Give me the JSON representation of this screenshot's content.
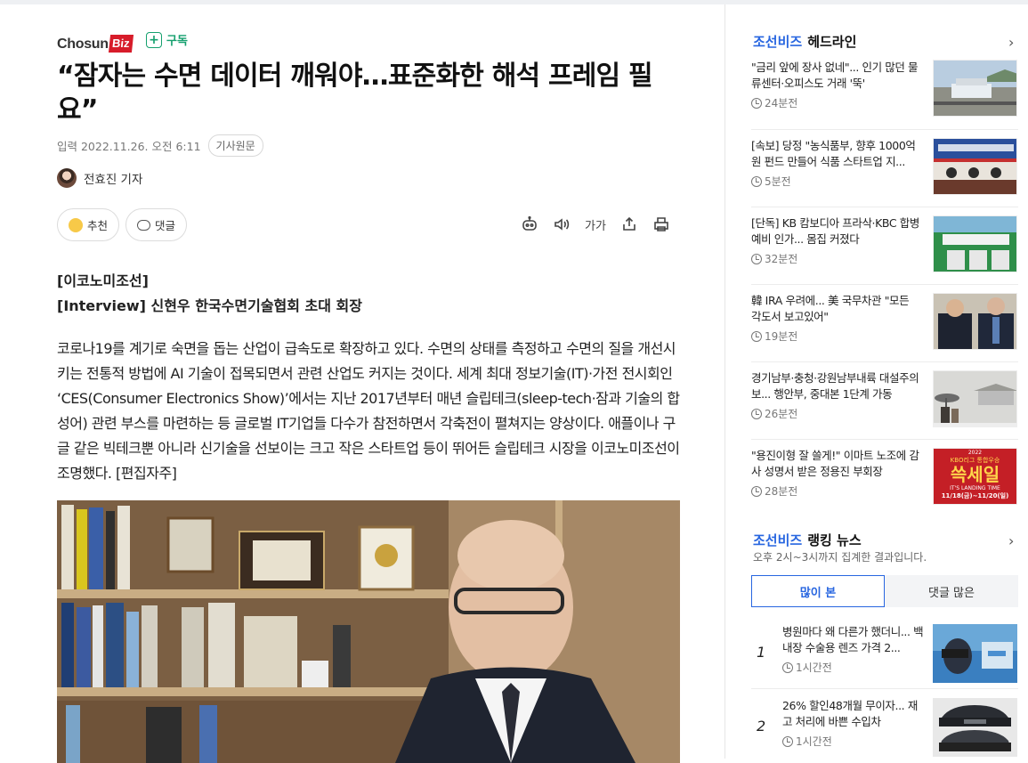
{
  "brand": {
    "logo_main": "Chosun",
    "logo_badge": "Biz",
    "subscribe_label": "구독"
  },
  "article": {
    "headline": "“잠자는 수면 데이터 깨워야…표준화한 해석 프레임 필요”",
    "published": "입력 2022.11.26. 오전 6:11",
    "source_tag": "기사원문",
    "author": "전효진 기자",
    "recommend_label": "추천",
    "comment_label": "댓글",
    "font_size_label": "가가",
    "series_label": "[이코노미조선]",
    "interview_label": "[Interview]",
    "interview_subject": "신현우 한국수면기술협회 초대 회장",
    "body": "코로나19를 계기로 숙면을 돕는 산업이 급속도로 확장하고 있다. 수면의 상태를 측정하고 수면의 질을 개선시키는 전통적 방법에 AI 기술이 접목되면서 관련 산업도 커지는 것이다. 세계 최대 정보기술(IT)·가전 전시회인 ‘CES(Consumer Electronics Show)’에서는 지난 2017년부터 매년 슬립테크(sleep-tech·잠과 기술의 합성어) 관련 부스를 마련하는 등 글로벌 IT기업들 다수가 참전하면서 각축전이 펼쳐지는 양상이다. 애플이나 구글 같은 빅테크뿐 아니라 신기술을 선보이는 크고 작은 스타트업 등이 뛰어든 슬립테크 시장을 이코노미조선이 조명했다. [편집자주]"
  },
  "sidebar": {
    "headline_brand": "조선비즈",
    "headline_title": "헤드라인",
    "headlines": [
      {
        "title": "\"금리 앞에 장사 없네\"... 인기 많던 물류센터·오피스도 거래 '뚝'",
        "time": "24분전"
      },
      {
        "title": "[속보] 당정 \"농식품부, 향후 1000억원 펀드 만들어 식품 스타트업 지...",
        "time": "5분전"
      },
      {
        "title": "[단독] KB 캄보디아 프라삭·KBC 합병 예비 인가... 몸집 커졌다",
        "time": "32분전"
      },
      {
        "title": "韓 IRA 우려에... 美 국무차관 \"모든 각도서 보고있어\"",
        "time": "19분전"
      },
      {
        "title": "경기남부·충청·강원남부내륙 대설주의보... 행안부, 중대본 1단계 가동",
        "time": "26분전"
      },
      {
        "title": "\"용진이형 잘 쓸게!\" 이마트 노조에 감사 성명서 받은 정용진 부회장",
        "time": "28분전"
      }
    ],
    "promo_text": {
      "year": "2022",
      "event": "KBO리그 통합우승",
      "big": "쓱세일",
      "tagline": "IT'S LANDING TIME",
      "dates": "11/18(금)~11/20(일)"
    },
    "ranking_brand": "조선비즈",
    "ranking_title": "랭킹 뉴스",
    "ranking_sub": "오후 2시~3시까지 집계한 결과입니다.",
    "tabs": [
      "많이 본",
      "댓글 많은"
    ],
    "ranking": [
      {
        "rank": "1",
        "title": "병원마다 왜 다른가 했더니... 백내장 수술용 렌즈 가격 2...",
        "time": "1시간전"
      },
      {
        "rank": "2",
        "title": "26% 할인48개월 무이자... 재고 처리에 바쁜 수입차",
        "time": "1시간전"
      }
    ]
  }
}
